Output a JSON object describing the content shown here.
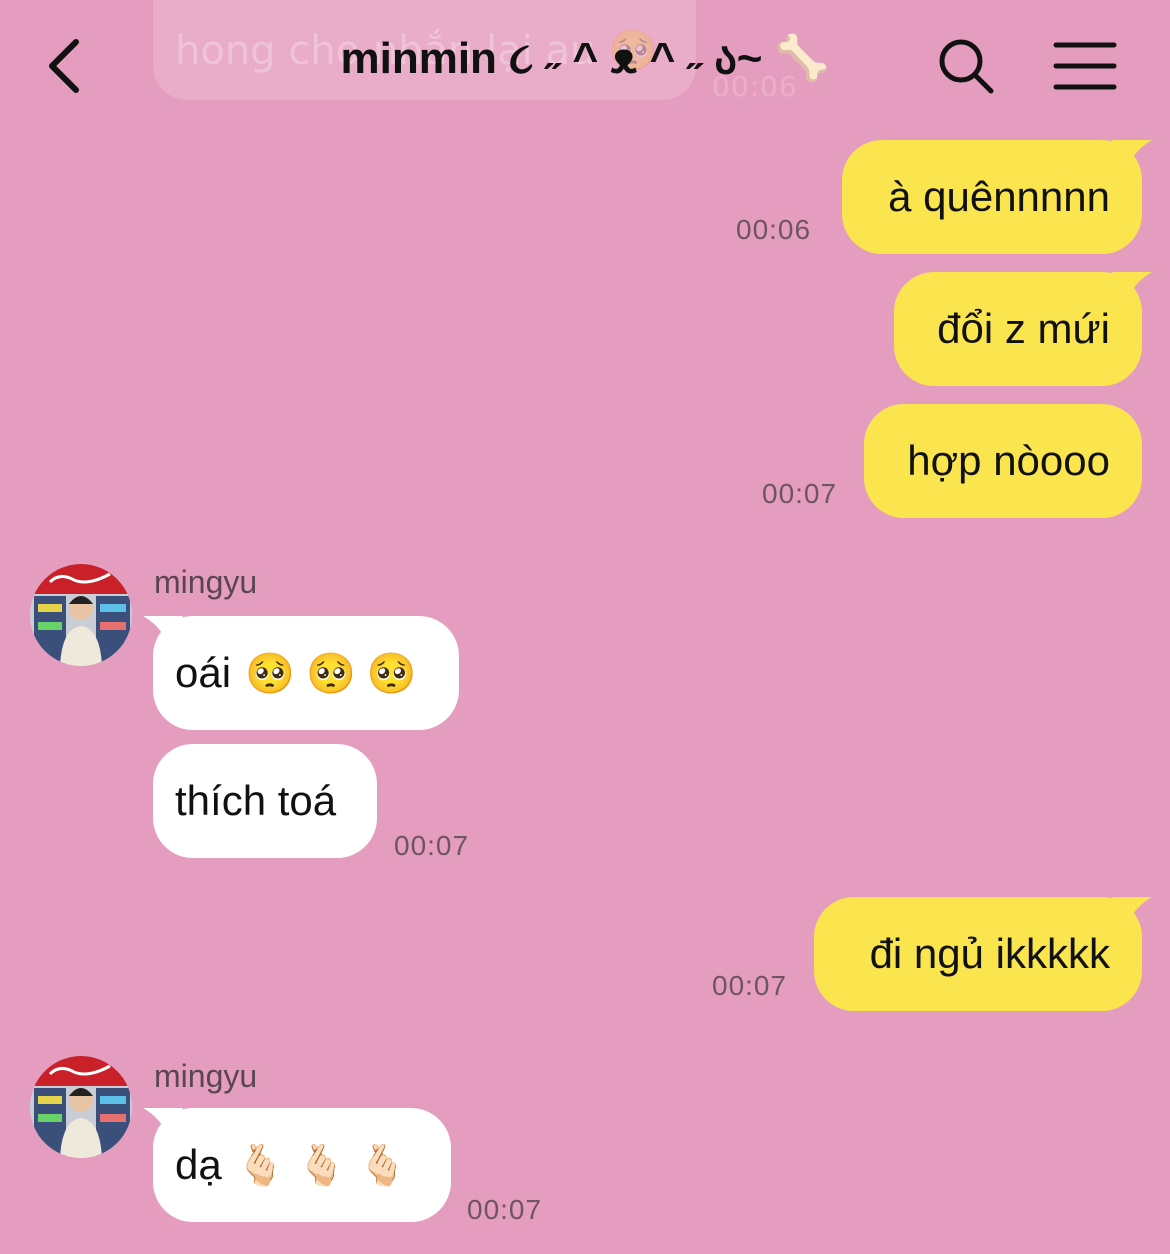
{
  "header": {
    "title": "minmin ૮ ˶ ^ ᴥ ^ ˶ ა~ 🦴",
    "back_icon": "chevron-left-icon",
    "search_icon": "search-icon",
    "menu_icon": "hamburger-menu-icon"
  },
  "faded_previous": {
    "text": "hong cho nhắn lại au 🥺",
    "time": "00:06"
  },
  "messages": [
    {
      "dir": "out",
      "text": "à quênnnnn",
      "time": "00:06"
    },
    {
      "dir": "out",
      "text": "đổi z mứi",
      "time": ""
    },
    {
      "dir": "out",
      "text": "hợp nòooo",
      "time": "00:07"
    },
    {
      "dir": "in",
      "sender": "mingyu",
      "text": "oái",
      "emoji": "🥺 🥺 🥺",
      "time": ""
    },
    {
      "dir": "in",
      "text": "thích toá",
      "time": "00:07"
    },
    {
      "dir": "out",
      "text": "đi ngủ ikkkkk",
      "time": "00:07"
    },
    {
      "dir": "in",
      "sender": "mingyu",
      "text": "dạ",
      "emoji": "🫰🏻 🫰🏻 🫰🏻",
      "time": "00:07"
    }
  ],
  "colors": {
    "background": "#e59dbf",
    "outgoing_bubble": "#fae54e",
    "incoming_bubble": "#ffffff"
  }
}
